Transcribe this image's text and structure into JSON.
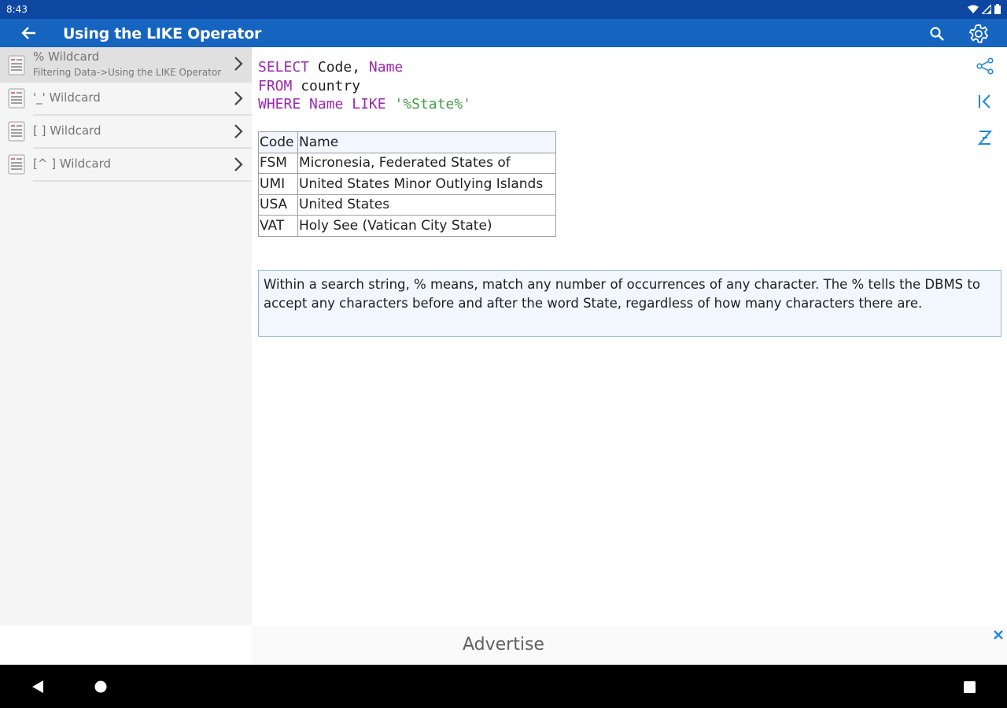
{
  "status_bar": {
    "time": "8:43"
  },
  "app_bar": {
    "title": "Using the LIKE Operator"
  },
  "sidebar": {
    "items": [
      {
        "label": "% Wildcard",
        "sublabel": "Filtering Data->Using the LIKE Operator",
        "selected": true
      },
      {
        "label": "'_' Wildcard"
      },
      {
        "label": "[ ] Wildcard"
      },
      {
        "label": "[^ ] Wildcard"
      }
    ]
  },
  "sql": {
    "line1": {
      "kw1": "SELECT",
      "plain1": " Code, ",
      "kw2": "Name"
    },
    "line2": {
      "kw1": "FROM",
      "plain1": " country"
    },
    "line3": {
      "kw1": "WHERE",
      "plain1": " ",
      "kw2": "Name",
      "plain2": " ",
      "kw3": "LIKE",
      "plain3": " ",
      "str": "'%State%'"
    }
  },
  "result_table": {
    "headers": [
      "Code",
      "Name"
    ],
    "rows": [
      [
        "FSM",
        "Micronesia, Federated States of"
      ],
      [
        "UMI",
        "United States Minor Outlying Islands"
      ],
      [
        "USA",
        "United States"
      ],
      [
        "VAT",
        "Holy See (Vatican City State)"
      ]
    ]
  },
  "note": {
    "text": "Within a search string, % means, match any number of occurrences of any character. The % tells the DBMS to accept any characters before and after the word State, regardless of how many characters there are."
  },
  "ad": {
    "text": "Advertise"
  },
  "colors": {
    "status_bar": "#0d47a1",
    "app_bar": "#1565c0",
    "keyword": "#9c27b0",
    "string": "#43a047",
    "note_bg": "#f1f7fd",
    "note_border": "#90b4e0"
  },
  "icons": {
    "back": "arrow-left-icon",
    "search": "search-icon",
    "settings": "gear-icon",
    "share": "share-icon",
    "first": "skip-first-icon",
    "last": "sort-z-icon",
    "close": "close-icon"
  }
}
